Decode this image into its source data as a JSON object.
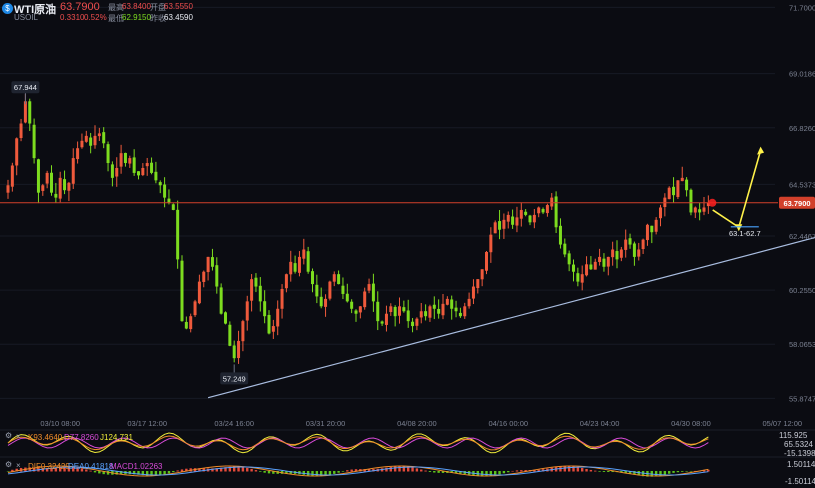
{
  "header": {
    "symbol": "WTI原油",
    "code": "USOIL",
    "last": "63.7900",
    "change": "0.3310",
    "change_pct": "0.52%",
    "high_label": "最高",
    "high": "63.8400",
    "open_label": "开盘",
    "open": "63.5550",
    "low_label": "最低",
    "low": "62.9150",
    "prev_label": "昨收",
    "prev": "63.4590"
  },
  "colors": {
    "up": "#ef5a3c",
    "down": "#7ddc1f",
    "background": "#0b0c12",
    "trendline": "#a9bde0",
    "last_price_line": "#d2402b",
    "projection": "#fff24a"
  },
  "indicators": {
    "kdj_k": "K93.4640",
    "kdj_d": "D77.8260",
    "kdj_j": "J124.731",
    "macd_dif": "DIF0.32429",
    "macd_dea": "DEA0.41818",
    "macd": "MACD1.02263",
    "kdj_axis": [
      "115.925",
      "65.5324",
      "-15.1398"
    ],
    "macd_axis": [
      "1.50114",
      "-1.50114"
    ]
  },
  "chart_data": {
    "type": "candlestick",
    "y_ticks": [
      "71.7000",
      "69.0186",
      "66.8260",
      "64.5373",
      "62.4467",
      "60.2550",
      "58.0653",
      "55.8747"
    ],
    "y_tick_values": [
      71.7,
      69.0186,
      66.826,
      64.5373,
      62.4467,
      60.255,
      58.0653,
      55.8747
    ],
    "ylim": [
      55.2,
      72.0
    ],
    "x_ticks": [
      "03/10 08:00",
      "03/17 12:00",
      "03/24 16:00",
      "03/31 20:00",
      "04/08 20:00",
      "04/16 00:00",
      "04/23 04:00",
      "04/30 08:00",
      "05/07 12:00"
    ],
    "x_tick_index": [
      12,
      32,
      52,
      73,
      94,
      115,
      136,
      157,
      178
    ],
    "last_price": "63.7900",
    "last_price_value": 63.79,
    "annotations": {
      "high_label": "67.944",
      "high_value": 67.944,
      "high_index": 4,
      "low_label": "57.249",
      "low_value": 57.249,
      "low_index": 52,
      "target_label": "63.1-62.7",
      "target_value": 62.9
    },
    "trendline": {
      "start_index": 46,
      "start_value": 55.9,
      "end_index": 202,
      "end_value": 63.15
    },
    "projection": {
      "start_index": 162,
      "start_value": 63.5,
      "mid_index": 168,
      "mid_value": 62.8,
      "end_index": 173,
      "end_value": 65.9
    },
    "closes": [
      64.5,
      65.3,
      66.4,
      67.0,
      67.9,
      67.0,
      65.6,
      64.2,
      64.5,
      65.0,
      64.2,
      64.0,
      64.8,
      64.3,
      64.6,
      65.6,
      66.0,
      66.3,
      66.5,
      66.1,
      66.5,
      66.6,
      66.2,
      65.4,
      64.8,
      65.2,
      65.8,
      65.4,
      65.6,
      65.0,
      64.9,
      65.2,
      65.4,
      65.0,
      64.7,
      64.5,
      64.0,
      63.8,
      63.5,
      61.5,
      59.0,
      58.7,
      59.2,
      59.8,
      60.6,
      61.0,
      61.6,
      61.2,
      60.4,
      59.3,
      58.9,
      58.0,
      57.5,
      58.2,
      59.0,
      59.8,
      60.7,
      60.4,
      59.8,
      59.2,
      58.5,
      58.8,
      59.5,
      60.3,
      60.9,
      61.4,
      61.0,
      61.6,
      61.9,
      61.0,
      60.5,
      60.0,
      59.6,
      59.9,
      60.6,
      60.9,
      60.5,
      60.1,
      59.8,
      59.5,
      59.3,
      59.6,
      60.2,
      60.5,
      59.8,
      59.0,
      58.9,
      59.3,
      59.6,
      59.2,
      59.6,
      59.4,
      59.0,
      58.8,
      59.1,
      59.4,
      59.2,
      59.6,
      59.5,
      59.3,
      59.7,
      59.9,
      59.5,
      59.4,
      59.2,
      59.6,
      59.9,
      60.4,
      60.7,
      61.1,
      61.8,
      62.5,
      63.0,
      62.7,
      63.1,
      63.3,
      62.9,
      63.2,
      63.5,
      63.3,
      63.0,
      63.3,
      63.6,
      63.4,
      63.7,
      64.0,
      62.8,
      62.1,
      61.7,
      61.3,
      61.0,
      60.6,
      60.9,
      61.3,
      61.1,
      61.4,
      61.6,
      61.2,
      61.6,
      61.9,
      61.5,
      61.9,
      62.3,
      62.1,
      61.6,
      61.9,
      62.3,
      62.9,
      62.6,
      63.1,
      63.6,
      64.0,
      64.4,
      64.1,
      64.7,
      64.8,
      64.3,
      63.4,
      63.6,
      63.4,
      63.6,
      63.79
    ]
  }
}
